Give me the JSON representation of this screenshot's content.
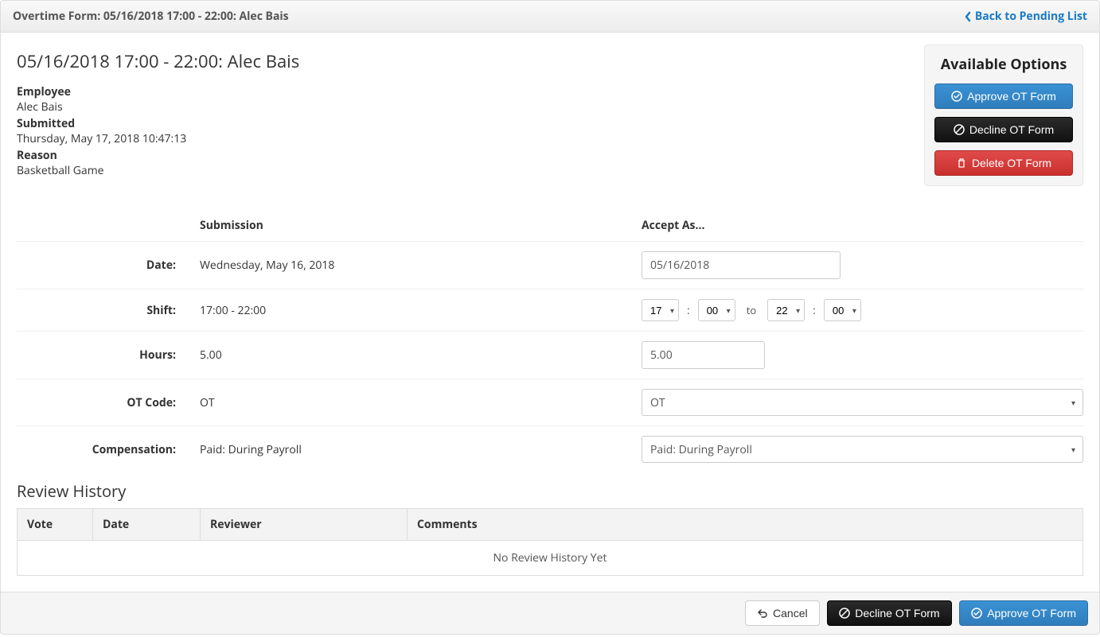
{
  "header": {
    "title": "Overtime Form: 05/16/2018 17:00 - 22:00: Alec Bais",
    "back_label": "Back to Pending List"
  },
  "page_title": "05/16/2018 17:00 - 22:00: Alec Bais",
  "meta": {
    "employee_label": "Employee",
    "employee_value": "Alec Bais",
    "submitted_label": "Submitted",
    "submitted_value": "Thursday, May 17, 2018 10:47:13",
    "reason_label": "Reason",
    "reason_value": "Basketball Game"
  },
  "options": {
    "title": "Available Options",
    "approve_label": "Approve OT Form",
    "decline_label": "Decline OT Form",
    "delete_label": "Delete OT Form"
  },
  "columns": {
    "submission": "Submission",
    "accept_as": "Accept As..."
  },
  "rows": {
    "date": {
      "label": "Date:",
      "submission": "Wednesday, May 16, 2018",
      "accept_value": "05/16/2018"
    },
    "shift": {
      "label": "Shift:",
      "submission": "17:00 - 22:00",
      "start_hour": "17",
      "start_min": "00",
      "to_text": "to",
      "end_hour": "22",
      "end_min": "00"
    },
    "hours": {
      "label": "Hours:",
      "submission": "5.00",
      "accept_value": "5.00"
    },
    "otcode": {
      "label": "OT Code:",
      "submission": "OT",
      "accept_value": "OT"
    },
    "comp": {
      "label": "Compensation:",
      "submission": "Paid: During Payroll",
      "accept_value": "Paid: During Payroll"
    }
  },
  "review": {
    "title": "Review History",
    "headers": {
      "vote": "Vote",
      "date": "Date",
      "reviewer": "Reviewer",
      "comments": "Comments"
    },
    "empty": "No Review History Yet"
  },
  "footer": {
    "cancel_label": "Cancel",
    "decline_label": "Decline OT Form",
    "approve_label": "Approve OT Form"
  }
}
